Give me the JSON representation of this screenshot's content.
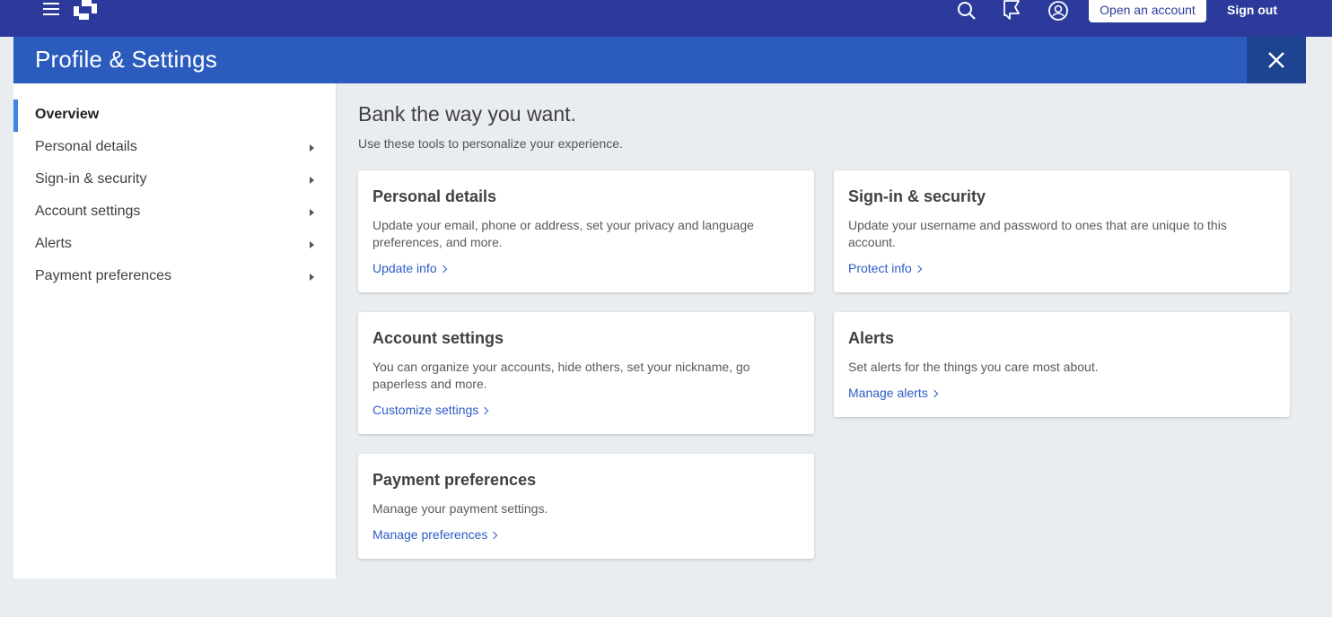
{
  "topbar": {
    "open_account_label": "Open an account",
    "sign_out_label": "Sign out",
    "icons": [
      "menu-icon",
      "chase-logo",
      "search-icon",
      "chat-icon",
      "profile-icon"
    ]
  },
  "header": {
    "title": "Profile & Settings"
  },
  "sidebar": {
    "items": [
      {
        "label": "Overview",
        "active": true
      },
      {
        "label": "Personal details"
      },
      {
        "label": "Sign-in & security"
      },
      {
        "label": "Account settings"
      },
      {
        "label": "Alerts"
      },
      {
        "label": "Payment preferences"
      }
    ]
  },
  "main": {
    "title": "Bank the way you want.",
    "subtitle": "Use these tools to personalize your experience."
  },
  "cards": [
    {
      "title": "Personal details",
      "description": "Update your email, phone or address, set your privacy and language preferences, and more.",
      "link": "Update info"
    },
    {
      "title": "Sign-in & security",
      "description": "Update your username and password to ones that are unique to this account.",
      "link": "Protect info"
    },
    {
      "title": "Account settings",
      "description": "You can organize your accounts, hide others, set your nickname, go paperless and more.",
      "link": "Customize settings"
    },
    {
      "title": "Alerts",
      "description": "Set alerts for the things you care most about.",
      "link": "Manage alerts"
    },
    {
      "title": "Payment preferences",
      "description": "Manage your payment settings.",
      "link": "Manage preferences"
    }
  ],
  "colors": {
    "topbar": "#2c3b9b",
    "header": "#2a5bbd",
    "close": "#1e4390",
    "accent": "#3c85e0",
    "link": "#2c5cc5",
    "background": "#eaedf0"
  }
}
